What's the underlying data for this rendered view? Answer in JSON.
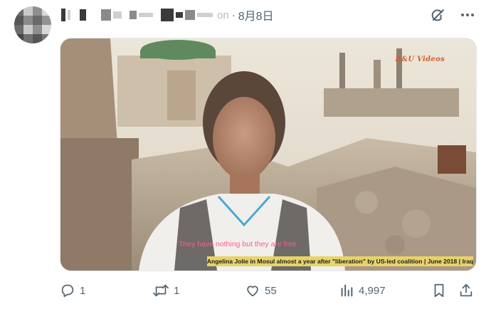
{
  "post": {
    "date": "8月8日",
    "handle_tail": "on",
    "separator": "·"
  },
  "media": {
    "watermark": "R&U Videos",
    "subtitle": "They have nothing but they are free",
    "caption": "Angelina Jolie in Mosul almost a year after \"liberation\" by US-led coalition | June 2018 | Iraq"
  },
  "actions": {
    "reply_count": "1",
    "repost_count": "1",
    "like_count": "55",
    "view_count": "4,997"
  },
  "icons": {
    "grok": "grok-icon",
    "more": "more-options-icon",
    "reply": "reply-icon",
    "repost": "repost-icon",
    "like": "like-icon",
    "views": "views-icon",
    "bookmark": "bookmark-icon",
    "share": "share-icon"
  },
  "colors": {
    "icon_gray": "#536471",
    "caption_bar": "#e7d36a",
    "subtitle_pink": "#ff5c8a",
    "watermark_orange": "#d0612a"
  }
}
